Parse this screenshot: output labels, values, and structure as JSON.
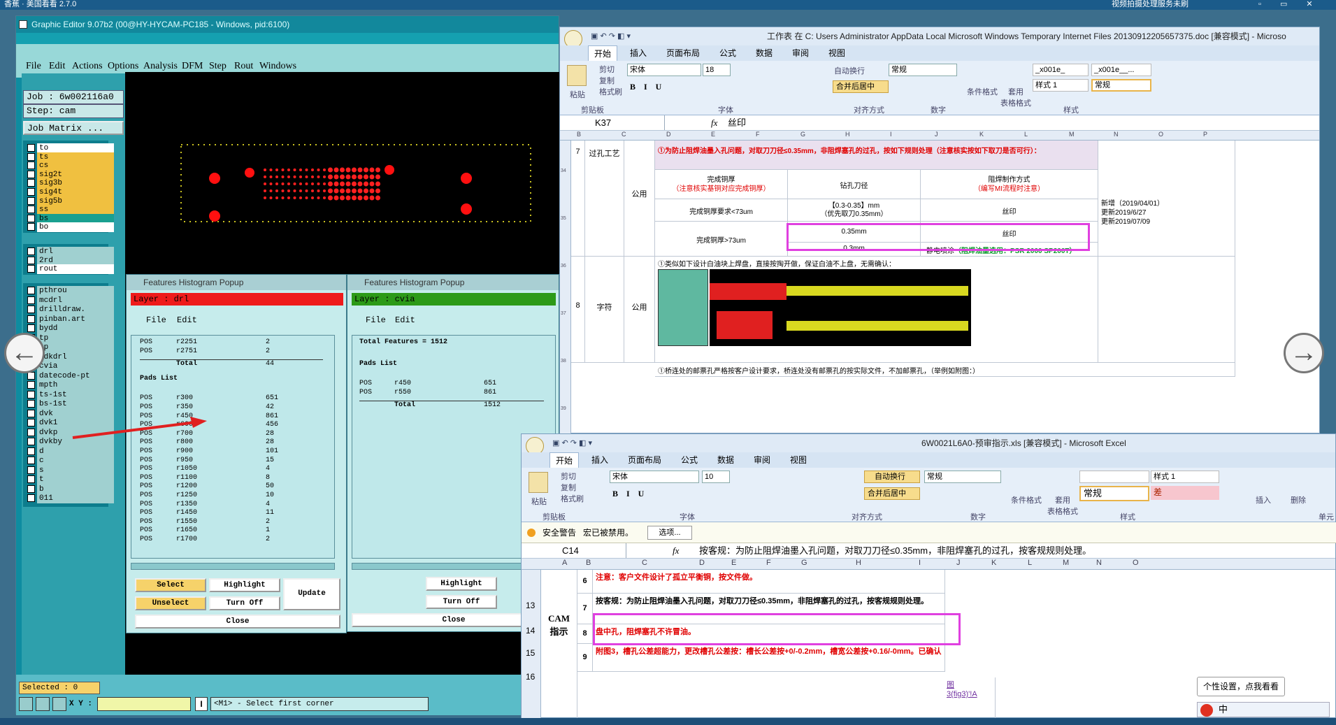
{
  "topbar": {
    "title": "香蕉 · 美国看看 2.7.0",
    "right_text": "视频拍摄处理服务未刷"
  },
  "cam": {
    "title": "Graphic Editor 9.07b2 (00@HY-HYCAM-PC185 - Windows, pid:6100)",
    "menu": [
      "File",
      "Edit",
      "Actions",
      "Options",
      "Analysis",
      "DFM",
      "Step",
      "Rout",
      "Windows"
    ],
    "job": "Job  : 6w002116a0",
    "step": "Step: cam",
    "matrix": "Job Matrix ...",
    "layers1": [
      {
        "n": "to",
        "c": "#ffffff"
      },
      {
        "n": "ts",
        "c": "#f0c040"
      },
      {
        "n": "cs",
        "c": "#f0c040"
      },
      {
        "n": "sig2t",
        "c": "#f0c040"
      },
      {
        "n": "sig3b",
        "c": "#f0c040"
      },
      {
        "n": "sig4t",
        "c": "#f0c040"
      },
      {
        "n": "sig5b",
        "c": "#f0c040"
      },
      {
        "n": "ss",
        "c": "#f0c040"
      },
      {
        "n": "bs",
        "c": "#1aa090"
      },
      {
        "n": "bo",
        "c": "#ffffff"
      }
    ],
    "layers2": [
      {
        "n": "drl",
        "c": "#a0d0d0"
      },
      {
        "n": "2rd",
        "c": "#a0d0d0"
      },
      {
        "n": "rout",
        "c": "#ffffff"
      }
    ],
    "layers3": [
      "pthrou",
      "mcdrl",
      "drilldraw.",
      "pinban.art",
      "bydd",
      "tp",
      "bp",
      "rdkdrl",
      "cvia",
      "datecode-pt",
      "mpth",
      "ts-1st",
      "bs-1st",
      "dvk",
      "dvk1",
      "dvkp",
      "dvkby",
      "d",
      "c",
      "s",
      "t",
      "b",
      "011"
    ],
    "selected": "Selected : 0",
    "xy_label": "X Y :",
    "prompt": "<M1> - Select first corner"
  },
  "hist1": {
    "title": "Features Histogram Popup",
    "layer": "Layer : drl",
    "menu": [
      "File",
      "Edit"
    ],
    "top_rows": [
      [
        "POS",
        "r2251",
        "2"
      ],
      [
        "POS",
        "r2751",
        "2"
      ]
    ],
    "total_label": "Total",
    "total": "44",
    "pads_label": "Pads List",
    "rows": [
      [
        "POS",
        "r300",
        "651"
      ],
      [
        "POS",
        "r350",
        "42"
      ],
      [
        "POS",
        "r450",
        "861"
      ],
      [
        "POS",
        "r600",
        "456"
      ],
      [
        "POS",
        "r700",
        "28"
      ],
      [
        "POS",
        "r800",
        "28"
      ],
      [
        "POS",
        "r900",
        "101"
      ],
      [
        "POS",
        "r950",
        "15"
      ],
      [
        "POS",
        "r1050",
        "4"
      ],
      [
        "POS",
        "r1100",
        "8"
      ],
      [
        "POS",
        "r1200",
        "50"
      ],
      [
        "POS",
        "r1250",
        "10"
      ],
      [
        "POS",
        "r1350",
        "4"
      ],
      [
        "POS",
        "r1450",
        "11"
      ],
      [
        "POS",
        "r1550",
        "2"
      ],
      [
        "POS",
        "r1650",
        "1"
      ],
      [
        "POS",
        "r1700",
        "2"
      ]
    ],
    "buttons": {
      "select": "Select",
      "highlight": "Highlight",
      "update": "Update",
      "unselect": "Unselect",
      "turnoff": "Turn Off",
      "close": "Close"
    }
  },
  "hist2": {
    "title": "Features Histogram Popup",
    "layer": "Layer : cvia",
    "menu": [
      "File",
      "Edit"
    ],
    "total_features": "Total Features = 1512",
    "pads_label": "Pads List",
    "rows": [
      [
        "POS",
        "r450",
        "651"
      ],
      [
        "POS",
        "r550",
        "861"
      ]
    ],
    "total_label": "Total",
    "total": "1512",
    "buttons": {
      "highlight": "Highlight",
      "turnoff": "Turn Off",
      "close": "Close"
    }
  },
  "xl1": {
    "title": "工作表 在 C: Users Administrator AppData Local Microsoft Windows Temporary Internet Files 20130912205657375.doc [兼容模式] - Microso",
    "tabs": [
      "开始",
      "插入",
      "页面布局",
      "公式",
      "数据",
      "审阅",
      "视图"
    ],
    "font": "宋体",
    "size": "18",
    "numfmt": "常规",
    "groups": [
      "剪贴板",
      "字体",
      "对齐方式",
      "数字",
      "样式"
    ],
    "clip": [
      "剪切",
      "复制",
      "格式刷"
    ],
    "paste": "粘贴",
    "wrap": "自动换行",
    "merge": "合并后居中",
    "style_buttons": [
      "条件格式",
      "套用\n表格格式"
    ],
    "styles": [
      "_x001e_",
      "_x001e__...",
      "样式 1",
      "常规"
    ],
    "cellref": "K37",
    "fx": "丝印",
    "cols": [
      "B",
      "C",
      "D",
      "E",
      "F",
      "G",
      "H",
      "I",
      "J",
      "K",
      "L",
      "M",
      "N",
      "O",
      "P"
    ],
    "rownums": [
      "34",
      "35",
      "36",
      "37",
      "38",
      "39"
    ],
    "r7_num": "7",
    "r7_name": "过孔工艺",
    "r7_scope": "公用",
    "r7_note": "①为防止阻焊油墨入孔问题，对取刀刀径≤0.35mm，非阻焊塞孔的过孔，按如下规则处理（注意核实按如下取刀是否可行）：",
    "hdr_cu": "完成铜厚",
    "hdr_cu_note": "（注意核实基铜对应完成铜厚）",
    "hdr_drill": "钻孔刀径",
    "hdr_mask": "阻焊制作方式",
    "hdr_mask_note": "（编写MI流程时注意）",
    "r_a_cu": "完成铜厚要求<73um",
    "r_a_drill": "【0.3-0.35】mm",
    "r_a_drill2": "（优先取刀0.35mm）",
    "r_a_mask": "丝印",
    "r_b_cu": "完成铜厚>73um",
    "r_b_drill": "0.35mm",
    "r_b_mask": "丝印",
    "r_c_drill": "0.3mm",
    "r_c_mask": "静电喷涂",
    "r_c_note": "（阻焊油墨选用：PSR 2000 SP200T）",
    "side": [
      "新增（2019/04/01）",
      "更新2019/6/27",
      "更新2019/07/09"
    ],
    "r8_num": "8",
    "r8_name": "字符",
    "r8_scope": "公用",
    "r8_note": "①类似如下设计白油块上焊盘，直接按掏开做，保证白油不上盘，无需确认：",
    "r9_note": "①桥连处的邮票孔严格按客户设计要求，桥连处没有邮票孔的按实际文件，不加邮票孔，（举例如附图：）"
  },
  "xl2": {
    "title": "6W0021L6A0-预审指示.xls [兼容模式] - Microsoft Excel",
    "tabs": [
      "开始",
      "插入",
      "页面布局",
      "公式",
      "数据",
      "审阅",
      "视图"
    ],
    "font": "宋体",
    "size": "10",
    "numfmt": "常规",
    "groups": [
      "剪贴板",
      "字体",
      "对齐方式",
      "数字",
      "样式",
      "单元"
    ],
    "clip": [
      "剪切",
      "复制",
      "格式刷"
    ],
    "paste": "粘贴",
    "wrap": "自动换行",
    "merge": "合并后居中",
    "style_buttons": [
      "条件格式",
      "套用\n表格格式"
    ],
    "styles": [
      "样式 1",
      "常规",
      "差"
    ],
    "insert": "插入",
    "delete": "删除",
    "security_label": "安全警告",
    "security_text": "宏已被禁用。",
    "options": "选项...",
    "cellref": "C14",
    "fx": "按客规：为防止阻焊油墨入孔问题，对取刀刀径≤0.35mm，非阻焊塞孔的过孔，按客规规则处理。",
    "cols": [
      "A",
      "B",
      "C",
      "D",
      "E",
      "F",
      "G",
      "H",
      "I",
      "J",
      "K",
      "L",
      "M",
      "N",
      "O"
    ],
    "rownums": [
      "13",
      "14",
      "15",
      "16"
    ],
    "section": "CAM\n指示",
    "rows": [
      {
        "n": "6",
        "t": "注意：客户文件设计了孤立平衡铜，按文件做。",
        "red": true
      },
      {
        "n": "7",
        "t": "按客规：为防止阻焊油墨入孔问题，对取刀刀径≤0.35mm，非阻焊塞孔的过孔，按客规规则处理。",
        "red": false
      },
      {
        "n": "8",
        "t": "盘中孔，阻焊塞孔不许冒油。",
        "red": true
      },
      {
        "n": "9",
        "t": "附图3，槽孔公差超能力，更改槽孔公差按：槽长公差按+0/-0.2mm，槽宽公差按+0.16/-0mm。已确认",
        "red": true
      }
    ],
    "link": "图\n3(fig3)'!A"
  },
  "tooltip": "个性设置，点我看看",
  "ime": "中",
  "colors": {
    "cam_bg": "#0e8ca0",
    "menu": "#98d8d8",
    "highlight": "#e040e0",
    "red": "#e00000"
  }
}
